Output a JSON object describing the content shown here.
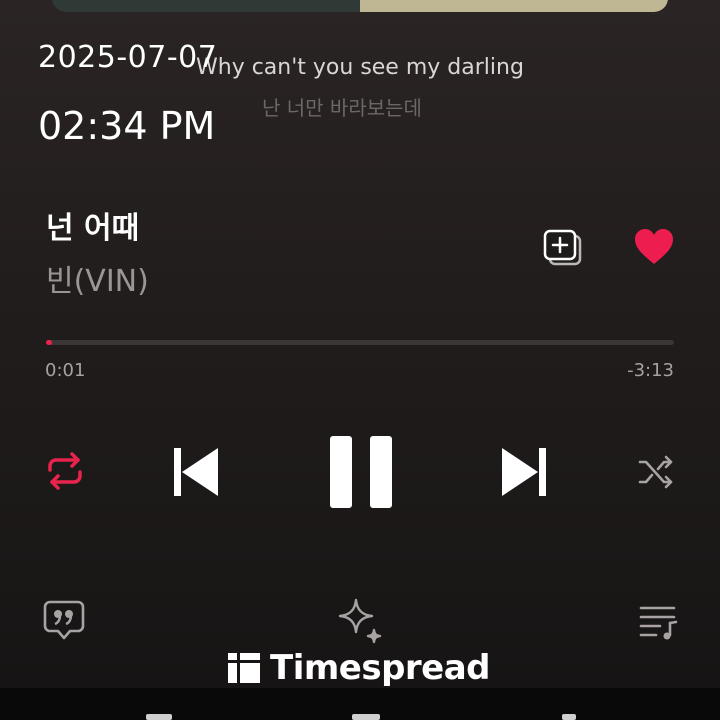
{
  "timestamp": {
    "date": "2025-07-07",
    "time": "02:34 PM"
  },
  "lyrics": {
    "current": "Why can't you see my darling",
    "next": "난 너만 바라보는데"
  },
  "track": {
    "title": "넌 어때",
    "artist": "빈(VIN)"
  },
  "progress": {
    "elapsed": "0:01",
    "remaining": "-3:13",
    "fraction": 0.006
  },
  "controls": {
    "repeat": "repeat-icon",
    "previous": "skip-previous-icon",
    "pause": "pause-icon",
    "next": "skip-next-icon",
    "shuffle": "shuffle-icon"
  },
  "bottom_bar": {
    "lyrics": "lyrics-quote-icon",
    "sparkle": "sparkle-icon",
    "queue": "queue-music-icon"
  },
  "watermark": {
    "text": "Timespread"
  },
  "colors": {
    "accent": "#e8234c",
    "background": "#221d1d",
    "text": "#ffffff",
    "muted": "#9b9595"
  }
}
